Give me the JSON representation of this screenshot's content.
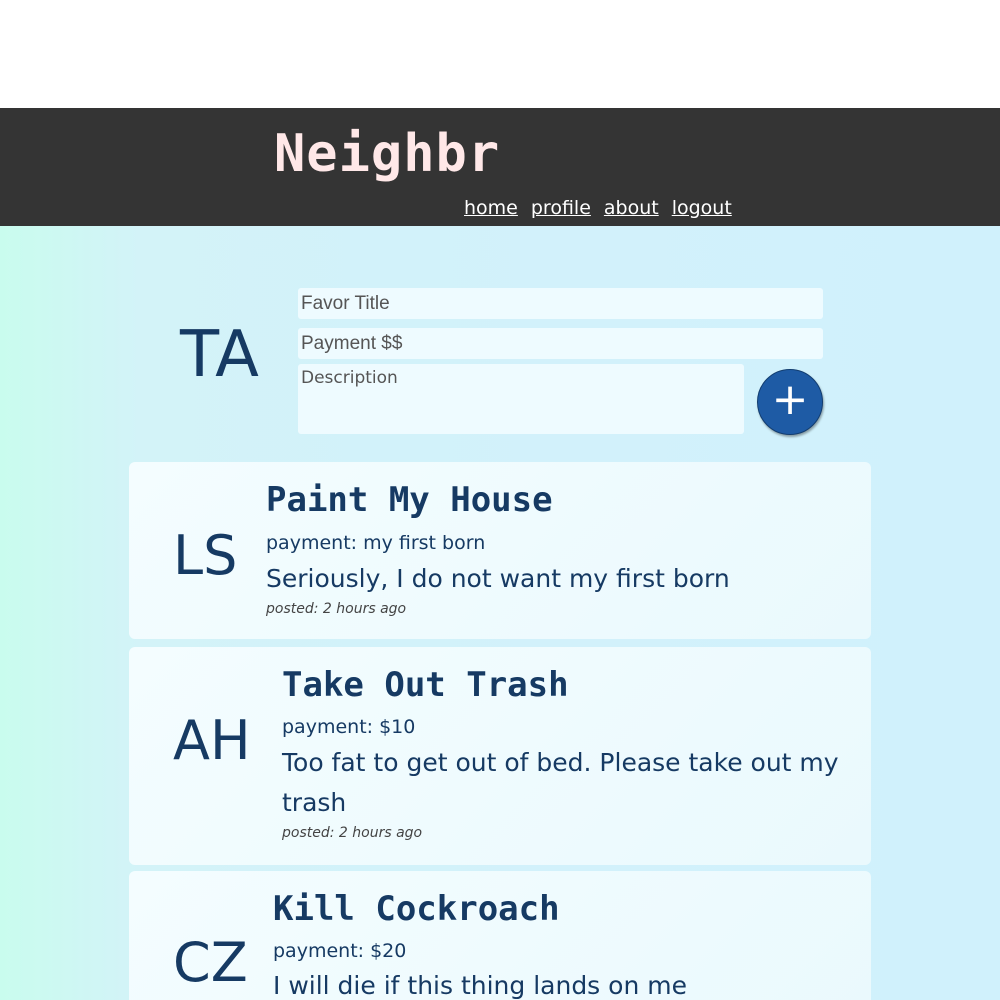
{
  "header": {
    "brand": "Neighbr",
    "nav": {
      "home": "home",
      "profile": "profile",
      "about": "about",
      "logout": "logout"
    }
  },
  "composer": {
    "initials": "TA",
    "title_placeholder": "Favor Title",
    "payment_placeholder": "Payment $$",
    "description_placeholder": "Description",
    "add_label": "+"
  },
  "favors": [
    {
      "initials": "LS",
      "title": "Paint My House",
      "payment": "payment: my first born",
      "description": "Seriously, I do not want my first born",
      "posted": "posted: 2 hours ago"
    },
    {
      "initials": "AH",
      "title": "Take Out Trash",
      "payment": "payment: $10",
      "description": "Too fat to get out of bed. Please take out my trash",
      "posted": "posted: 2 hours ago"
    },
    {
      "initials": "CZ",
      "title": "Kill Cockroach",
      "payment": "payment: $20",
      "description": "I will die if this thing lands on me"
    }
  ],
  "colors": {
    "header_bg": "#343434",
    "brand": "#ffe8e8",
    "text": "#163a63",
    "add_button": "#1e5ba5"
  }
}
